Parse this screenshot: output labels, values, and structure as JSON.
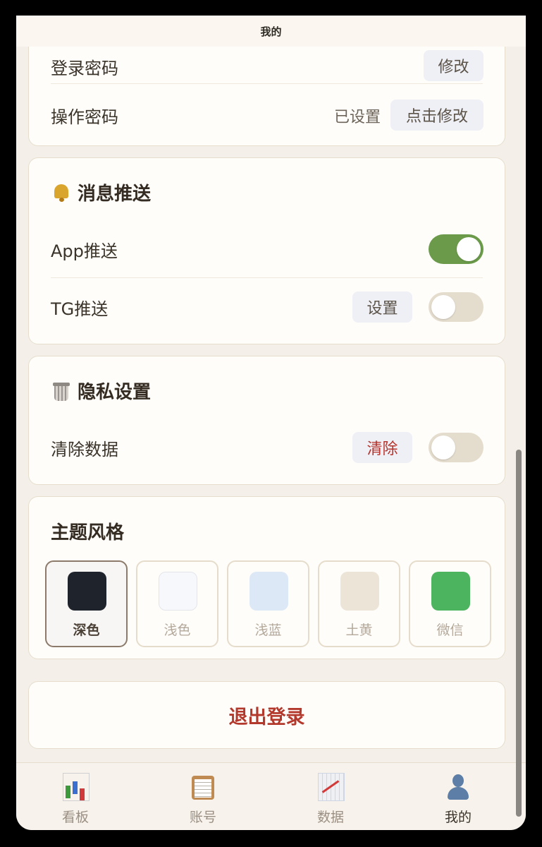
{
  "header": {
    "title": "我的"
  },
  "security": {
    "login_password": {
      "label": "登录密码",
      "button": "修改"
    },
    "op_password": {
      "label": "操作密码",
      "status": "已设置",
      "button": "点击修改"
    }
  },
  "push": {
    "title": "消息推送",
    "app": {
      "label": "App推送",
      "enabled": true
    },
    "tg": {
      "label": "TG推送",
      "button": "设置",
      "enabled": false
    }
  },
  "privacy": {
    "title": "隐私设置",
    "clear": {
      "label": "清除数据",
      "button": "清除",
      "enabled": false
    }
  },
  "theme": {
    "title": "主题风格",
    "options": [
      {
        "label": "深色",
        "color": "#1f232b",
        "selected": true
      },
      {
        "label": "浅色",
        "color": "#f7f8fb",
        "selected": false
      },
      {
        "label": "浅蓝",
        "color": "#dde8f7",
        "selected": false
      },
      {
        "label": "土黄",
        "color": "#ece4d6",
        "selected": false
      },
      {
        "label": "微信",
        "color": "#4cb35e",
        "selected": false
      }
    ]
  },
  "logout": {
    "label": "退出登录"
  },
  "tabs": [
    {
      "label": "看板",
      "icon": "chart-icon"
    },
    {
      "label": "账号",
      "icon": "clipboard-icon"
    },
    {
      "label": "数据",
      "icon": "linechart-icon"
    },
    {
      "label": "我的",
      "icon": "user-icon"
    }
  ],
  "colors": {
    "accent_green": "#6b9b4a",
    "danger": "#b3392d",
    "background": "#f4f0e9"
  }
}
